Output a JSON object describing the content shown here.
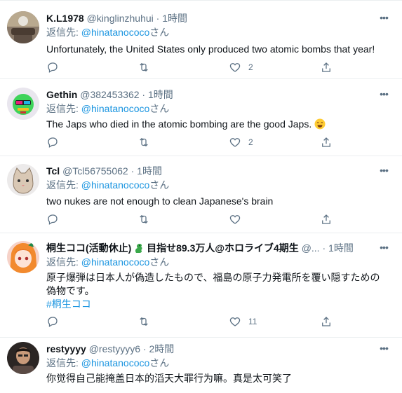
{
  "tweets": [
    {
      "name": "K.L1978",
      "handle": "@kinglinzhuhui",
      "time": "1時間",
      "reply_prefix": "返信先: ",
      "reply_handle": "@hinatanococo",
      "reply_suffix": "さん",
      "text": "Unfortunately, the United States only produced two atomic bombs that year!",
      "likes": "2"
    },
    {
      "name": "Gethin",
      "handle": "@382453362",
      "time": "1時間",
      "reply_prefix": "返信先: ",
      "reply_handle": "@hinatanococo",
      "reply_suffix": "さん",
      "text": "The Japs who died in the atomic bombing are the good Japs.",
      "likes": "2"
    },
    {
      "name": "Tcl",
      "handle": "@Tcl56755062",
      "time": "1時間",
      "reply_prefix": "返信先: ",
      "reply_handle": "@hinatanococo",
      "reply_suffix": "さん",
      "text": "two nukes are not enough to clean Japanese's brain",
      "likes": ""
    },
    {
      "name": "桐生ココ(活動休止)",
      "name_extra": "目指せ89.3万人@ホロライブ4期生",
      "handle": "@...",
      "time": "1時間",
      "reply_prefix": "返信先: ",
      "reply_handle": "@hinatanococo",
      "reply_suffix": "さん",
      "text": "原子爆弾は日本人が偽造したもので、福島の原子力発電所を覆い隠すための偽物です。",
      "hashtag": "#桐生ココ",
      "likes": "11"
    },
    {
      "name": "restyyyy",
      "handle": "@restyyyy6",
      "time": "2時間",
      "reply_prefix": "返信先: ",
      "reply_handle": "@hinatanococo",
      "reply_suffix": "さん",
      "text": "你觉得自己能掩盖日本的滔天大罪行为嘛。真是太可笑了"
    }
  ],
  "icons": {
    "more": "more-dots-icon",
    "reply": "reply-icon",
    "retweet": "retweet-icon",
    "like": "heart-icon",
    "share": "share-icon"
  },
  "colors": {
    "link": "#1b95e0",
    "secondary": "#5b7083",
    "divider": "#ebeef0"
  }
}
